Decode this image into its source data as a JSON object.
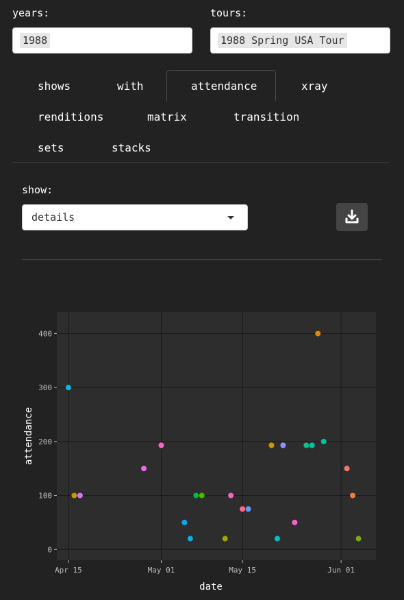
{
  "filters": {
    "years_label": "years:",
    "years_value": "1988",
    "tours_label": "tours:",
    "tours_value": "1988 Spring USA Tour"
  },
  "tabs": [
    {
      "label": "shows",
      "active": false
    },
    {
      "label": "with",
      "active": false
    },
    {
      "label": "attendance",
      "active": true
    },
    {
      "label": "xray",
      "active": false
    },
    {
      "label": "renditions",
      "active": false
    },
    {
      "label": "matrix",
      "active": false
    },
    {
      "label": "transition",
      "active": false
    },
    {
      "label": "sets",
      "active": false
    },
    {
      "label": "stacks",
      "active": false
    }
  ],
  "show": {
    "label": "show:",
    "selected": "details",
    "download_icon": "download-icon"
  },
  "chart_data": {
    "type": "scatter",
    "xlabel": "date",
    "ylabel": "attendance",
    "x_ticks": [
      "Apr 15",
      "May 01",
      "May 15",
      "Jun 01"
    ],
    "x_tick_dates": [
      "1988-04-15",
      "1988-05-01",
      "1988-05-15",
      "1988-06-01"
    ],
    "xlim": [
      "1988-04-13",
      "1988-06-07"
    ],
    "y_ticks": [
      0,
      100,
      200,
      300,
      400
    ],
    "ylim": [
      -20,
      440
    ],
    "grid": true,
    "legend": "none",
    "points": [
      {
        "date": "1988-04-15",
        "attendance": 300,
        "color": "#00b8e7"
      },
      {
        "date": "1988-04-16",
        "attendance": 100,
        "color": "#c49a00"
      },
      {
        "date": "1988-04-17",
        "attendance": 100,
        "color": "#d575fe"
      },
      {
        "date": "1988-04-28",
        "attendance": 150,
        "color": "#ef67eb"
      },
      {
        "date": "1988-05-01",
        "attendance": 193,
        "color": "#fd61d1"
      },
      {
        "date": "1988-05-05",
        "attendance": 50,
        "color": "#00a9ff"
      },
      {
        "date": "1988-05-06",
        "attendance": 20,
        "color": "#00b0f6"
      },
      {
        "date": "1988-05-07",
        "attendance": 100,
        "color": "#00ba38"
      },
      {
        "date": "1988-05-08",
        "attendance": 100,
        "color": "#53b400"
      },
      {
        "date": "1988-05-12",
        "attendance": 20,
        "color": "#a3a500"
      },
      {
        "date": "1988-05-13",
        "attendance": 100,
        "color": "#ff62bc"
      },
      {
        "date": "1988-05-15",
        "attendance": 75,
        "color": "#ff6c91"
      },
      {
        "date": "1988-05-16",
        "attendance": 75,
        "color": "#619cff"
      },
      {
        "date": "1988-05-20",
        "attendance": 193,
        "color": "#c99800"
      },
      {
        "date": "1988-05-21",
        "attendance": 20,
        "color": "#00bfc4"
      },
      {
        "date": "1988-05-22",
        "attendance": 193,
        "color": "#9590ff"
      },
      {
        "date": "1988-05-24",
        "attendance": 50,
        "color": "#fd61d1"
      },
      {
        "date": "1988-05-26",
        "attendance": 193,
        "color": "#00c08b"
      },
      {
        "date": "1988-05-27",
        "attendance": 193,
        "color": "#00c1a3"
      },
      {
        "date": "1988-05-28",
        "attendance": 400,
        "color": "#e58700"
      },
      {
        "date": "1988-05-29",
        "attendance": 200,
        "color": "#00c19a"
      },
      {
        "date": "1988-06-02",
        "attendance": 150,
        "color": "#f8766d"
      },
      {
        "date": "1988-06-03",
        "attendance": 100,
        "color": "#f07f40"
      },
      {
        "date": "1988-06-04",
        "attendance": 20,
        "color": "#7cae00"
      }
    ]
  }
}
